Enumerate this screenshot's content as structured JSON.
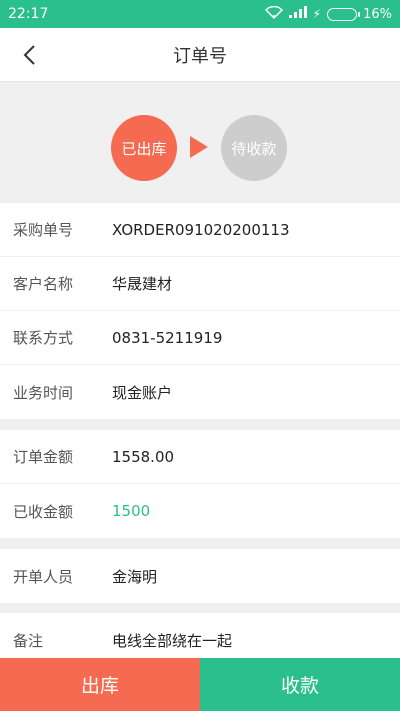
{
  "status_bar": {
    "time": "22:17",
    "battery": "16%",
    "wifi_icon": "wifi-icon",
    "signal_icon": "signal-icon",
    "charging_icon": "bolt-icon"
  },
  "navbar": {
    "title": "订单号",
    "back_icon": "chevron-left-icon"
  },
  "steps": {
    "done_label": "已出库",
    "todo_label": "待收款",
    "done_color": "#f56b52",
    "todo_color": "#cdcdcd"
  },
  "info": [
    {
      "label": "采购单号",
      "value": "XORDER091020200113"
    },
    {
      "label": "客户名称",
      "value": "华晟建材"
    },
    {
      "label": "联系方式",
      "value": "0831-5211919"
    },
    {
      "label": "业务时间",
      "value": "现金账户"
    }
  ],
  "amounts": [
    {
      "label": "订单金额",
      "value": "1558.00"
    },
    {
      "label": "已收金额",
      "value": "1500"
    }
  ],
  "staff": [
    {
      "label": "开单人员",
      "value": "金海明"
    }
  ],
  "notes": [
    {
      "label": "备注",
      "value": "电线全部绕在一起"
    }
  ],
  "actions": {
    "outbound_label": "出库",
    "collect_label": "收款"
  },
  "colors": {
    "accent_green": "#2bbf8e",
    "accent_red": "#f56b52"
  }
}
